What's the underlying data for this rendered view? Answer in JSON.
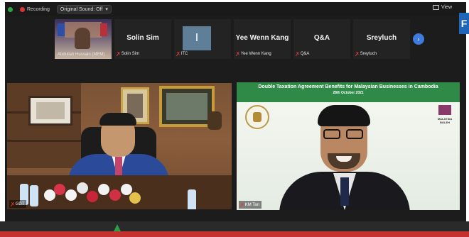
{
  "top_bar": {
    "recording_label": "Recording",
    "sound_toggle_label": "Original Sound: Off",
    "view_label": "View"
  },
  "participants": [
    {
      "big_name": "",
      "label": "Abdullah Hussain (MEM)",
      "muted": false,
      "has_video": true
    },
    {
      "big_name": "Solin Sim",
      "label": "Solin Sim",
      "muted": true,
      "has_video": false
    },
    {
      "big_name": "I",
      "label": "ITC",
      "muted": true,
      "has_video": false
    },
    {
      "big_name": "Yee Wenn Kang",
      "label": "Yee Wenn Kang",
      "muted": true,
      "has_video": false
    },
    {
      "big_name": "Q&A",
      "label": "Q&A",
      "muted": true,
      "has_video": false
    },
    {
      "big_name": "Sreyluch",
      "label": "Sreyluch",
      "muted": true,
      "has_video": false
    }
  ],
  "main_left": {
    "label": "GDT"
  },
  "main_right": {
    "banner_title": "Double Taxation Agreement Benefits for Malaysian Businesses in Cambodia",
    "banner_date": "28th October 2021",
    "logo_text": "MALAYSIA BOLEH",
    "label": "KM Tan"
  },
  "icons": {
    "next": "chevron-right-icon",
    "mic_off": "mic-off-icon"
  },
  "colors": {
    "banner_green": "#2f8a48",
    "accent_blue": "#3d7bdc",
    "muted_red": "#e53935",
    "bottom_red": "#c3322e"
  }
}
